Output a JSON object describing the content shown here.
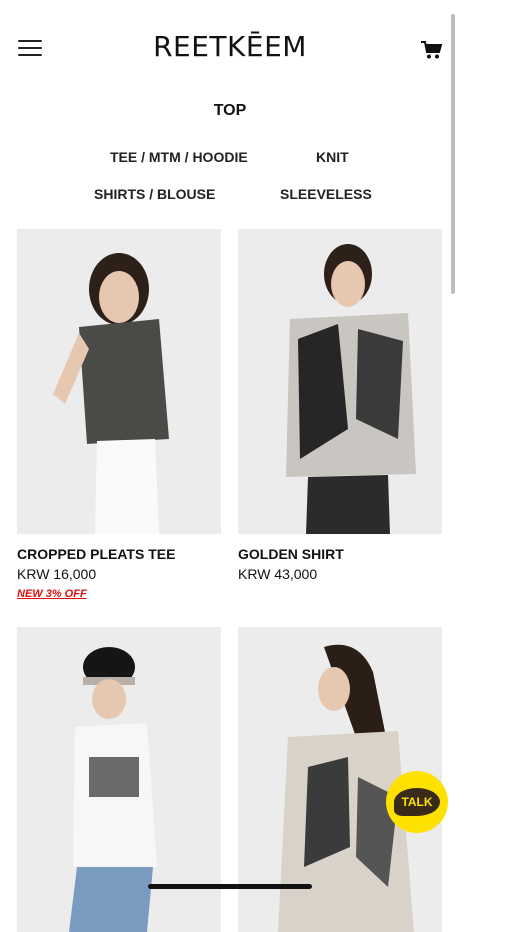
{
  "brand": {
    "logo": "REETKĒEM"
  },
  "category": {
    "title": "TOP",
    "subcategories": [
      "TEE / MTM / HOODIE",
      "KNIT",
      "SHIRTS / BLOUSE",
      "SLEEVELESS"
    ]
  },
  "products": [
    {
      "name": "CROPPED PLEATS TEE",
      "price": "KRW 16,000",
      "badge": "NEW 3% OFF"
    },
    {
      "name": "GOLDEN SHIRT",
      "price": "KRW 43,000"
    },
    {
      "name": "",
      "price": ""
    },
    {
      "name": "",
      "price": ""
    }
  ],
  "chat": {
    "label": "TALK"
  },
  "colors": {
    "badge": "#dd1111",
    "talk": "#ffe100",
    "talk_text": "#3a2a1a"
  },
  "icons": [
    "hamburger-menu-icon",
    "cart-icon",
    "talk-chat-icon"
  ]
}
